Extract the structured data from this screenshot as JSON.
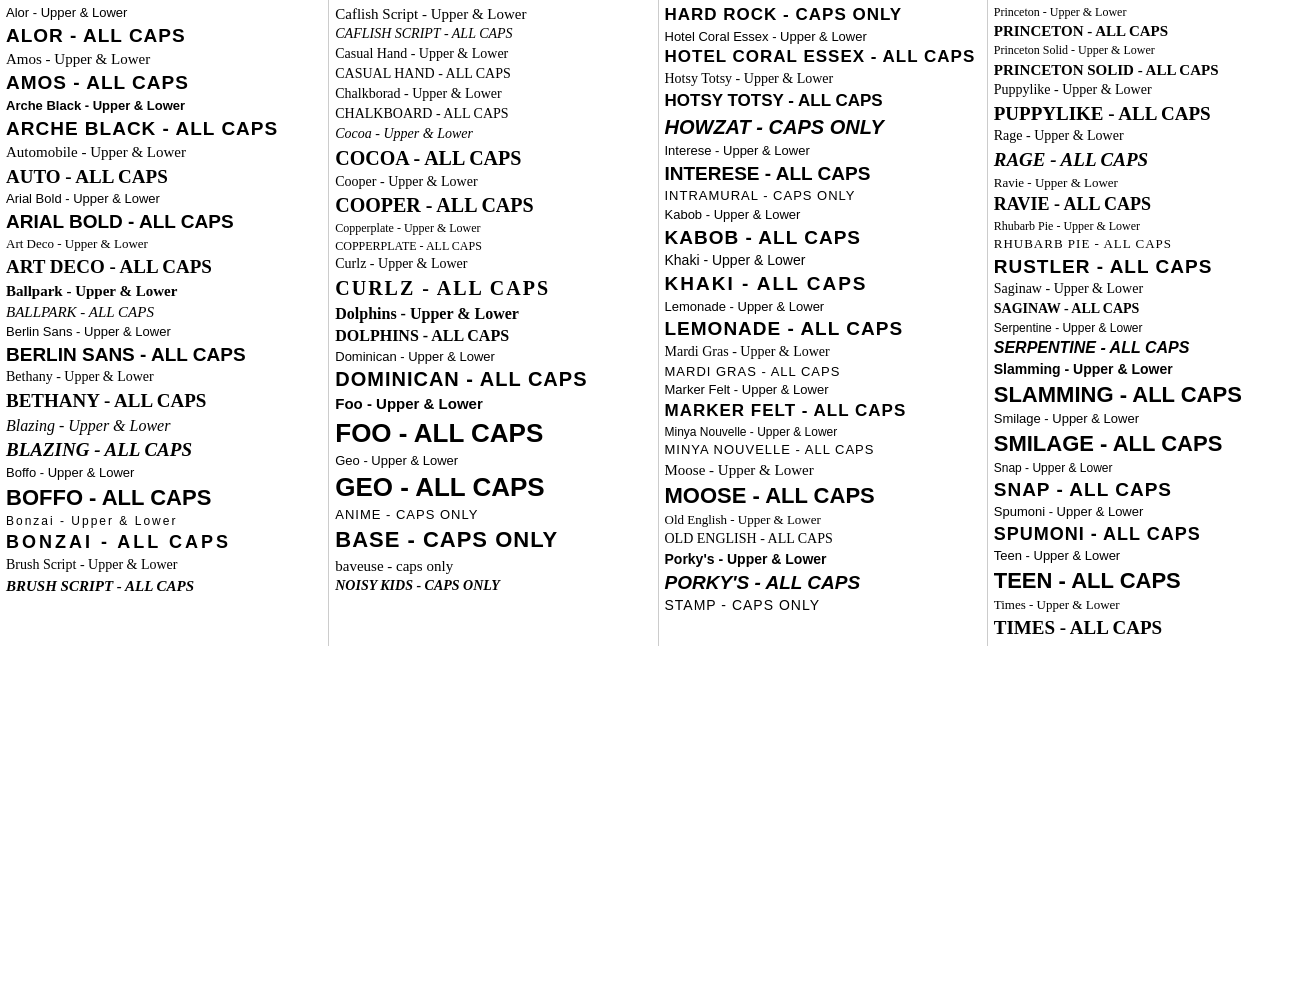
{
  "columns": [
    {
      "id": "col1",
      "entries": [
        {
          "label": "Alor - Upper & Lower",
          "style": "alor-upper"
        },
        {
          "label": "ALOR - ALL CAPS",
          "style": "alor-caps"
        },
        {
          "label": "Amos - Upper & Lower",
          "style": "amos-upper"
        },
        {
          "label": "AMOS - ALL CAPS",
          "style": "amos-caps"
        },
        {
          "label": "Arche Black - Upper & Lower",
          "style": "arche-upper"
        },
        {
          "label": "ARCHE BLACK - ALL CAPS",
          "style": "arche-caps"
        },
        {
          "label": "Automobile - Upper & Lower",
          "style": "auto-upper"
        },
        {
          "label": "AUTO - ALL CAPS",
          "style": "auto-caps"
        },
        {
          "label": "Arial Bold - Upper & Lower",
          "style": "arial-upper"
        },
        {
          "label": "ARIAL BOLD - ALL CAPS",
          "style": "arial-caps"
        },
        {
          "label": "Art Deco - Upper & Lower",
          "style": "artdeco-upper"
        },
        {
          "label": "ART DECO - ALL CAPS",
          "style": "artdeco-caps"
        },
        {
          "label": "Ballpark - Upper & Lower",
          "style": "ballpark-upper"
        },
        {
          "label": "BALLPARK - ALL CAPS",
          "style": "ballpark-caps"
        },
        {
          "label": "Berlin Sans - Upper & Lower",
          "style": "berlin-upper"
        },
        {
          "label": "BERLIN SANS - ALL CAPS",
          "style": "berlin-caps"
        },
        {
          "label": "Bethany - Upper & Lower",
          "style": "bethany-upper"
        },
        {
          "label": "BETHANY - ALL CAPS",
          "style": "bethany-caps"
        },
        {
          "label": "Blazing - Upper & Lower",
          "style": "blazing-upper"
        },
        {
          "label": "BLAZING - ALL CAPS",
          "style": "blazing-caps"
        },
        {
          "label": "Boffo - Upper & Lower",
          "style": "boffo-upper"
        },
        {
          "label": "BOFFO - ALL CAPS",
          "style": "boffo-caps"
        },
        {
          "label": "Bonzai - Upper & Lower",
          "style": "bonzai-upper"
        },
        {
          "label": "BONZAI - ALL CAPS",
          "style": "bonzai-caps"
        },
        {
          "label": "Brush Script - Upper & Lower",
          "style": "brushscript-upper"
        },
        {
          "label": "BRUSH SCRIPT - ALL CAPS",
          "style": "brushscript-caps"
        }
      ]
    },
    {
      "id": "col2",
      "entries": [
        {
          "label": "Caflish Script - Upper & Lower",
          "style": "caflish-upper"
        },
        {
          "label": "CAFLISH SCRIPT - ALL CAPS",
          "style": "caflish-caps"
        },
        {
          "label": "Casual Hand - Upper & Lower",
          "style": "casualhand-upper"
        },
        {
          "label": "CASUAL HAND - ALL CAPS",
          "style": "casualhand-caps"
        },
        {
          "label": "Chalkborad - Upper & Lower",
          "style": "chalkboard-upper"
        },
        {
          "label": "CHALKBOARD - ALL CAPS",
          "style": "chalkboard-caps"
        },
        {
          "label": "Cocoa - Upper & Lower",
          "style": "cocoa-upper"
        },
        {
          "label": "COCOA - ALL CAPS",
          "style": "cocoa-caps"
        },
        {
          "label": "Cooper - Upper & Lower",
          "style": "cooper-upper"
        },
        {
          "label": "COOPER - ALL CAPS",
          "style": "cooper-caps"
        },
        {
          "label": "Copperplate - Upper & Lower",
          "style": "copperplate-upper"
        },
        {
          "label": "COPPERPLATE - ALL CAPS",
          "style": "copperplate-caps"
        },
        {
          "label": "Curlz - Upper & Lower",
          "style": "curlz-upper"
        },
        {
          "label": "CURLZ - ALL CAPS",
          "style": "curlz-caps"
        },
        {
          "label": "Dolphins - Upper & Lower",
          "style": "dolphins-upper"
        },
        {
          "label": "DOLPHINS - ALL CAPS",
          "style": "dolphins-caps"
        },
        {
          "label": "Dominican - Upper & Lower",
          "style": "dominican-upper"
        },
        {
          "label": "DOMINICAN - ALL CAPS",
          "style": "dominican-caps"
        },
        {
          "label": "Foo - Upper & Lower",
          "style": "foo-upper"
        },
        {
          "label": "FOO - ALL CAPS",
          "style": "foo-caps"
        },
        {
          "label": "Geo - Upper & Lower",
          "style": "geo-upper"
        },
        {
          "label": "GEO - ALL CAPS",
          "style": "geo-caps"
        },
        {
          "label": "ANIME - CAPS ONLY",
          "style": "anime-caps"
        },
        {
          "label": "BASE - CAPS ONLY",
          "style": "base-caps"
        },
        {
          "label": "baveuse - caps only",
          "style": "baveuse-caps"
        },
        {
          "label": "NOISY KIDS - CAPS ONLY",
          "style": "noisykids-caps"
        }
      ]
    },
    {
      "id": "col3",
      "entries": [
        {
          "label": "HARD ROCK - CAPS ONLY",
          "style": "hardrock-caps"
        },
        {
          "label": "Hotel Coral Essex - Upper & Lower",
          "style": "hotelcorel-upper"
        },
        {
          "label": "HOTEL CORAL ESSEX - ALL CAPS",
          "style": "hotelcorel-caps"
        },
        {
          "label": "Hotsy Totsy - Upper & Lower",
          "style": "hotsytotsy-upper"
        },
        {
          "label": "HOTSY TOTSY - ALL CAPS",
          "style": "hotsytotsy-caps"
        },
        {
          "label": "HOWZAT - CAPS ONLY",
          "style": "howzat-caps"
        },
        {
          "label": "Interese - Upper & Lower",
          "style": "interese-upper"
        },
        {
          "label": "INTERESE - ALL CAPS",
          "style": "interese-caps"
        },
        {
          "label": "INTRAMURAL - CAPS ONLY",
          "style": "intramural-caps"
        },
        {
          "label": "Kabob - Upper & Lower",
          "style": "kabob-upper"
        },
        {
          "label": "KABOB - ALL CAPS",
          "style": "kabob-caps"
        },
        {
          "label": "Khaki - Upper & Lower",
          "style": "khaki-upper"
        },
        {
          "label": "KHAKI - ALL CAPS",
          "style": "khaki-caps"
        },
        {
          "label": "Lemonade - Upper & Lower",
          "style": "lemonade-upper"
        },
        {
          "label": "LEMONADE - ALL CAPS",
          "style": "lemonade-caps"
        },
        {
          "label": "Mardi Gras - Upper & Lower",
          "style": "mardigras-upper"
        },
        {
          "label": "MARDI GRAS - ALL CAPS",
          "style": "mardigras-caps"
        },
        {
          "label": "Marker Felt - Upper & Lower",
          "style": "markerfelt-upper"
        },
        {
          "label": "MARKER FELT - ALL CAPS",
          "style": "markerfelt-caps"
        },
        {
          "label": "Minya Nouvelle - Upper & Lower",
          "style": "minya-upper"
        },
        {
          "label": "MINYA NOUVELLE - ALL CAPS",
          "style": "minya-caps"
        },
        {
          "label": "Moose - Upper & Lower",
          "style": "moose-upper"
        },
        {
          "label": "MOOSE - ALL CAPS",
          "style": "moose-caps"
        },
        {
          "label": "Old English - Upper & Lower",
          "style": "oldenglish-upper"
        },
        {
          "label": "OLD ENGLISH - ALL CAPS",
          "style": "oldenglish-caps"
        },
        {
          "label": "Porky's - Upper & Lower",
          "style": "porkys-upper"
        },
        {
          "label": "PORKY'S - ALL CAPS",
          "style": "porkys-caps"
        },
        {
          "label": "STAMP - CAPS ONLY",
          "style": "stamp-caps"
        }
      ]
    },
    {
      "id": "col4",
      "entries": [
        {
          "label": "Princeton - Upper & Lower",
          "style": "princeton-upper"
        },
        {
          "label": "PRINCETON - ALL CAPS",
          "style": "princeton-caps"
        },
        {
          "label": "Princeton Solid - Upper & Lower",
          "style": "princetonsolid-upper"
        },
        {
          "label": "PRINCETON SOLID - ALL CAPS",
          "style": "princetonsolid-caps"
        },
        {
          "label": "Puppylike - Upper & Lower",
          "style": "puppylike-upper"
        },
        {
          "label": "PUPPYLIKE - ALL CAPS",
          "style": "puppylike-caps"
        },
        {
          "label": "Rage - Upper & Lower",
          "style": "rage-upper"
        },
        {
          "label": "RAGE - ALL CAPS",
          "style": "rage-caps"
        },
        {
          "label": "Ravie - Upper & Lower",
          "style": "ravie-upper"
        },
        {
          "label": "RAVIE - ALL CAPS",
          "style": "ravie-caps"
        },
        {
          "label": "Rhubarb Pie - Upper & Lower",
          "style": "rhubarb-upper"
        },
        {
          "label": "RHUBARB PIE - ALL CAPS",
          "style": "rhubarb-caps"
        },
        {
          "label": "RUSTLER - ALL CAPS",
          "style": "rustler-caps"
        },
        {
          "label": "Saginaw - Upper & Lower",
          "style": "saginaw-upper"
        },
        {
          "label": "SAGINAW - ALL CAPS",
          "style": "saginaw-caps"
        },
        {
          "label": "Serpentine - Upper & Lower",
          "style": "serpentine-upper"
        },
        {
          "label": "SERPENTINE - ALL CAPS",
          "style": "serpentine-caps"
        },
        {
          "label": "Slamming - Upper & Lower",
          "style": "slamming-upper"
        },
        {
          "label": "SLAMMING - ALL CAPS",
          "style": "slamming-caps"
        },
        {
          "label": "Smilage - Upper & Lower",
          "style": "smilage-upper"
        },
        {
          "label": "SMILAGE - ALL CAPS",
          "style": "smilage-caps"
        },
        {
          "label": "Snap - Upper & Lower",
          "style": "snap-upper"
        },
        {
          "label": "SNAP - ALL CAPS",
          "style": "snap-caps"
        },
        {
          "label": "Spumoni - Upper & Lower",
          "style": "spumoni-upper"
        },
        {
          "label": "SPUMONI - ALL CAPS",
          "style": "spumoni-caps"
        },
        {
          "label": "Teen - Upper & Lower",
          "style": "teen-upper"
        },
        {
          "label": "TEEN - ALL CAPS",
          "style": "teen-caps"
        },
        {
          "label": "Times - Upper & Lower",
          "style": "times-upper"
        },
        {
          "label": "TIMES - ALL CAPS",
          "style": "times-caps"
        }
      ]
    }
  ]
}
